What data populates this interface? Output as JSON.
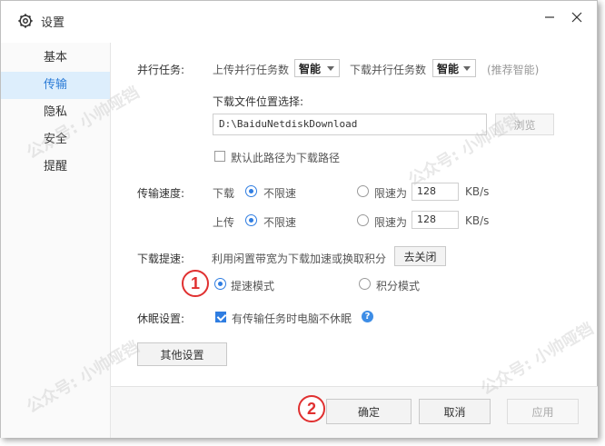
{
  "window": {
    "title": "设置"
  },
  "sidebar": {
    "items": [
      {
        "label": "基本",
        "active": false
      },
      {
        "label": "传输",
        "active": true
      },
      {
        "label": "隐私",
        "active": false
      },
      {
        "label": "安全",
        "active": false
      },
      {
        "label": "提醒",
        "active": false
      }
    ]
  },
  "parallel": {
    "label": "并行任务:",
    "upload_label": "上传并行任务数",
    "upload_value": "智能",
    "download_label": "下载并行任务数",
    "download_value": "智能",
    "hint": "(推荐智能)"
  },
  "download_location": {
    "label": "下载文件位置选择:",
    "path": "D:\\BaiduNetdiskDownload",
    "browse_label": "浏览",
    "default_checkbox_label": "默认此路径为下载路径",
    "default_checked": false
  },
  "speed": {
    "label": "传输速度:",
    "download_label": "下载",
    "upload_label": "上传",
    "unlimited_label": "不限速",
    "limit_label": "限速为",
    "download_limit": "128",
    "upload_limit": "128",
    "unit": "KB/s",
    "download_unlimited": true,
    "upload_unlimited": true
  },
  "accelerate": {
    "label": "下载提速:",
    "description": "利用闲置带宽为下载加速或换取积分",
    "close_button": "去关闭",
    "mode_speed": "提速模式",
    "mode_points": "积分模式",
    "selected": "speed"
  },
  "sleep": {
    "label": "休眠设置:",
    "checkbox_label": "有传输任务时电脑不休眠",
    "checked": true,
    "help_icon": "?"
  },
  "other_settings_button": "其他设置",
  "footer": {
    "ok_label": "确定",
    "cancel_label": "取消",
    "apply_label": "应用"
  },
  "annotations": {
    "badge1": "1",
    "badge2": "2"
  },
  "watermark": "公众号: 小帅哑铛",
  "colors": {
    "accent": "#2f7de1",
    "badge": "#e03030",
    "sidebar_active_bg": "#ddeefc"
  }
}
